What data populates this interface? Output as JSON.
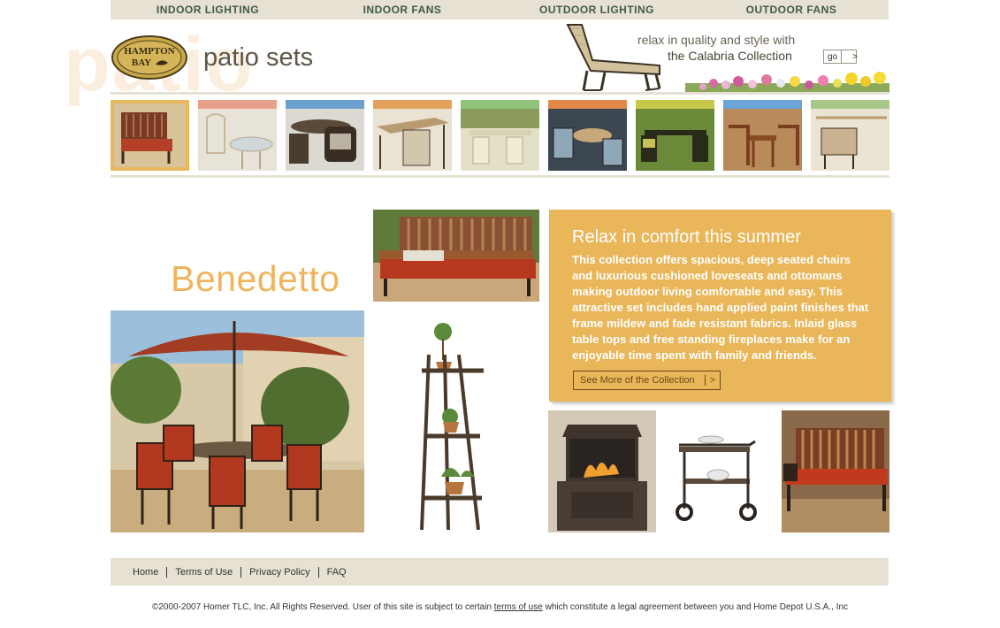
{
  "topnav": {
    "items": [
      "INDOOR LIGHTING",
      "INDOOR FANS",
      "OUTDOOR LIGHTING",
      "OUTDOOR FANS"
    ]
  },
  "header": {
    "watermark": "patio",
    "logo_line1": "HAMPTON",
    "logo_line2": "BAY",
    "title": "patio sets",
    "promo_line1": "relax in quality and style with",
    "promo_line2": "the Calabria Collection",
    "go_label": "go",
    "go_arrow": ">"
  },
  "thumbnails": [
    {
      "band": "#e8b95c",
      "selected": true
    },
    {
      "band": "#e8a08a",
      "selected": false
    },
    {
      "band": "#6a9fd0",
      "selected": false
    },
    {
      "band": "#e2a05a",
      "selected": false
    },
    {
      "band": "#8fc47a",
      "selected": false
    },
    {
      "band": "#e2894a",
      "selected": false
    },
    {
      "band": "#c7c84a",
      "selected": false
    },
    {
      "band": "#6aa4d8",
      "selected": false
    },
    {
      "band": "#a8c88a",
      "selected": false
    }
  ],
  "content": {
    "collection_name": "Benedetto",
    "promo_heading": "Relax in comfort this summer",
    "promo_body": "This collection offers spacious, deep seated chairs and luxurious cushioned loveseats and ottomans making outdoor living comfortable and easy. This attractive set includes hand applied paint finishes that frame mildew and fade resistant fabrics. Inlaid glass table tops and free standing fireplaces make for an enjoyable time spent with family and friends.",
    "see_more_label": "See More of the Collection",
    "see_more_arrow": ">"
  },
  "footer": {
    "links": [
      "Home",
      "Terms of Use",
      "Privacy Policy",
      "FAQ"
    ],
    "copyright_pre": "©2000-2007 Homer TLC, Inc. All Rights Reserved. User of this site is subject to certain ",
    "copyright_link": "terms of use",
    "copyright_post": " which constitute a legal agreement between you and Home Depot U.S.A., Inc"
  },
  "colors": {
    "accent": "#e9b659",
    "nav_bg": "#e6e1d3",
    "nav_text": "#3f5a4a",
    "collection_title": "#f0b45c"
  }
}
